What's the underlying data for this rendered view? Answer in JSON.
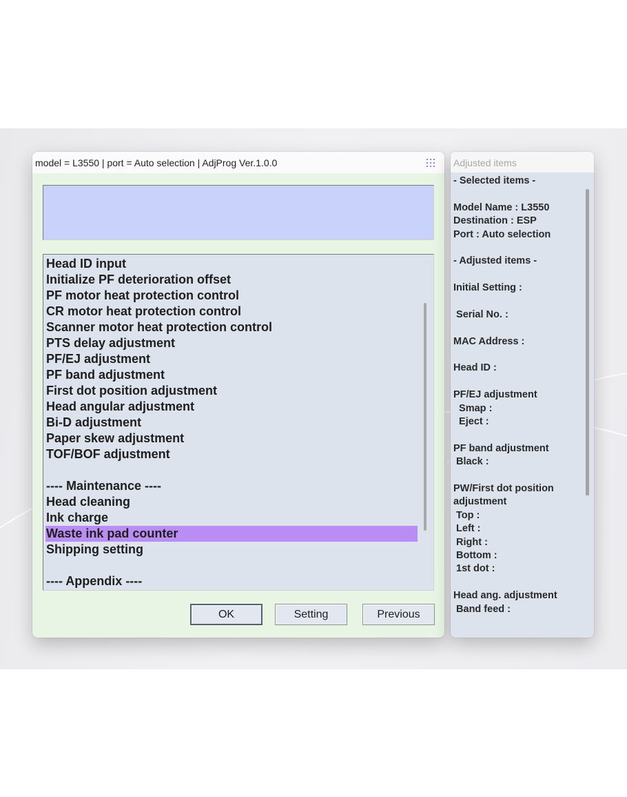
{
  "main_window": {
    "title": "model = L3550 | port = Auto selection | AdjProg Ver.1.0.0",
    "message": "",
    "list_items": [
      {
        "label": "Head ID input",
        "selected": false
      },
      {
        "label": "Initialize PF deterioration offset",
        "selected": false
      },
      {
        "label": "PF motor heat protection control",
        "selected": false
      },
      {
        "label": "CR motor heat protection control",
        "selected": false
      },
      {
        "label": "Scanner motor heat protection control",
        "selected": false
      },
      {
        "label": "PTS delay adjustment",
        "selected": false
      },
      {
        "label": "PF/EJ adjustment",
        "selected": false
      },
      {
        "label": "PF band adjustment",
        "selected": false
      },
      {
        "label": "First dot position adjustment",
        "selected": false
      },
      {
        "label": "Head angular adjustment",
        "selected": false
      },
      {
        "label": "Bi-D adjustment",
        "selected": false
      },
      {
        "label": "Paper skew adjustment",
        "selected": false
      },
      {
        "label": "TOF/BOF adjustment",
        "selected": false
      },
      {
        "label": "",
        "selected": false
      },
      {
        "label": "---- Maintenance ----",
        "selected": false
      },
      {
        "label": "Head cleaning",
        "selected": false
      },
      {
        "label": "Ink charge",
        "selected": false
      },
      {
        "label": "Waste ink pad counter",
        "selected": true
      },
      {
        "label": "Shipping setting",
        "selected": false
      },
      {
        "label": "",
        "selected": false
      },
      {
        "label": "---- Appendix ----",
        "selected": false
      }
    ],
    "buttons": {
      "ok": "OK",
      "setting": "Setting",
      "previous": "Previous"
    }
  },
  "side_panel": {
    "title": "Adjusted items",
    "lines": [
      "- Selected items -",
      "",
      "Model Name : L3550",
      "Destination : ESP",
      "Port : Auto selection",
      "",
      "- Adjusted items -",
      "",
      "Initial Setting :",
      "",
      " Serial No. :",
      "",
      "MAC Address :",
      "",
      "Head ID :",
      "",
      "PF/EJ adjustment",
      "  Smap :",
      "  Eject :",
      "",
      "PF band adjustment",
      " Black :",
      "",
      "PW/First dot position",
      "adjustment",
      " Top :",
      " Left :",
      " Right :",
      " Bottom :",
      " 1st dot :",
      "",
      "Head ang. adjustment",
      " Band feed :"
    ]
  },
  "colors": {
    "main_bg": "#e8f5e5",
    "message_bg": "#c8d2fb",
    "list_bg": "#dce3ec",
    "selected_bg": "#b98df4",
    "side_title_color": "#a7a7a7"
  },
  "icons": {
    "titlebar_grid": "grid-dots-icon"
  }
}
